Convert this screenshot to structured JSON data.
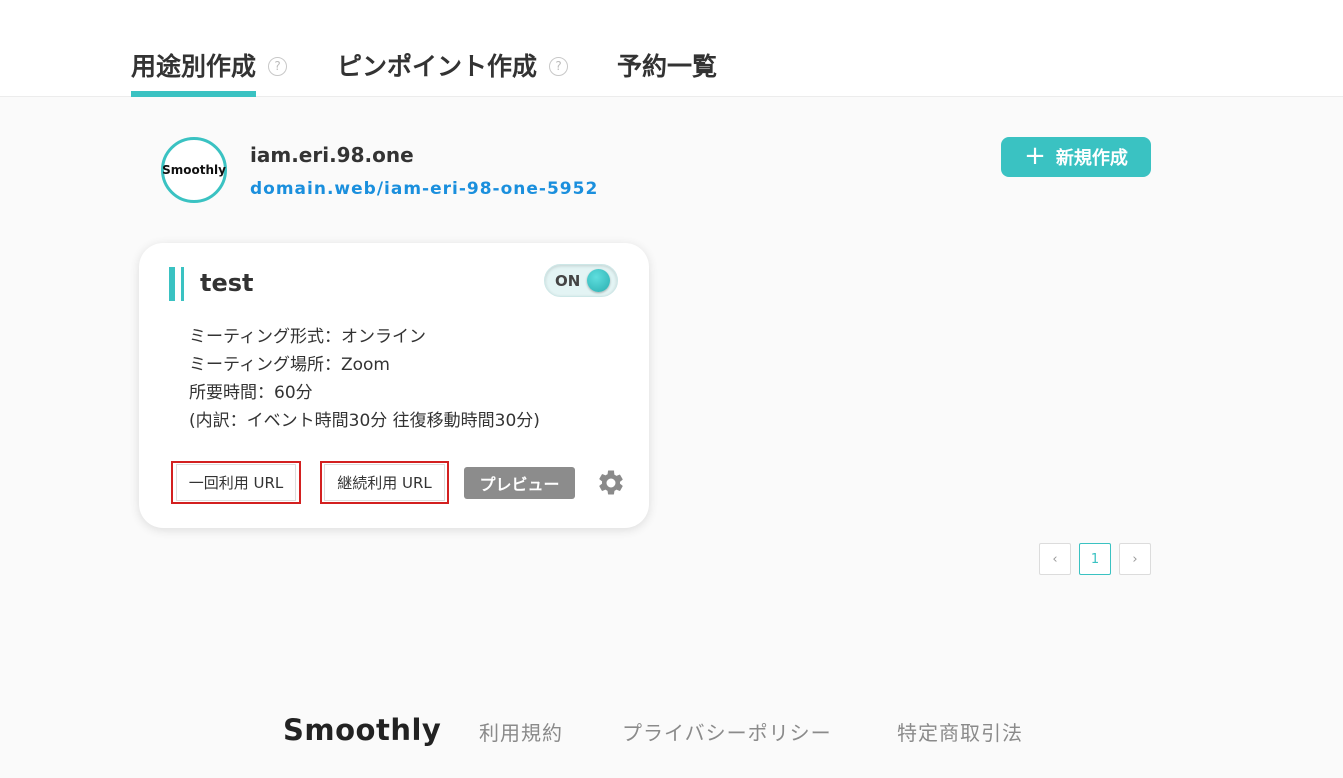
{
  "tabs": [
    {
      "label": "用途別作成",
      "help": "?"
    },
    {
      "label": "ピンポイント作成",
      "help": "?"
    },
    {
      "label": "予約一覧"
    }
  ],
  "profile": {
    "avatar_text": "Smoothly",
    "name": "iam.eri.98.one",
    "url": "domain.web/iam-eri-98-one-5952"
  },
  "new_button": {
    "icon": "+",
    "label": "新規作成"
  },
  "card": {
    "title": "test",
    "toggle": {
      "label": "ON",
      "state": "on"
    },
    "details": [
      "ミーティング形式：オンライン",
      "ミーティング場所：Zoom",
      "所要時間：60分",
      "(内訳：イベント時間30分 往復移動時間30分)"
    ],
    "buttons": {
      "single_url": "一回利用 URL",
      "continuous_url": "継続利用 URL",
      "preview": "プレビュー"
    }
  },
  "pagination": {
    "prev": "‹",
    "current": "1",
    "next": "›"
  },
  "footer": {
    "logo": "Smoothly",
    "links": [
      "利用規約",
      "プライバシーポリシー",
      "特定商取引法"
    ]
  },
  "colors": {
    "accent": "#3ac2c2",
    "link": "#1a8fdd",
    "highlight_border": "#d32020",
    "preview_bg": "#8c8c8c"
  }
}
